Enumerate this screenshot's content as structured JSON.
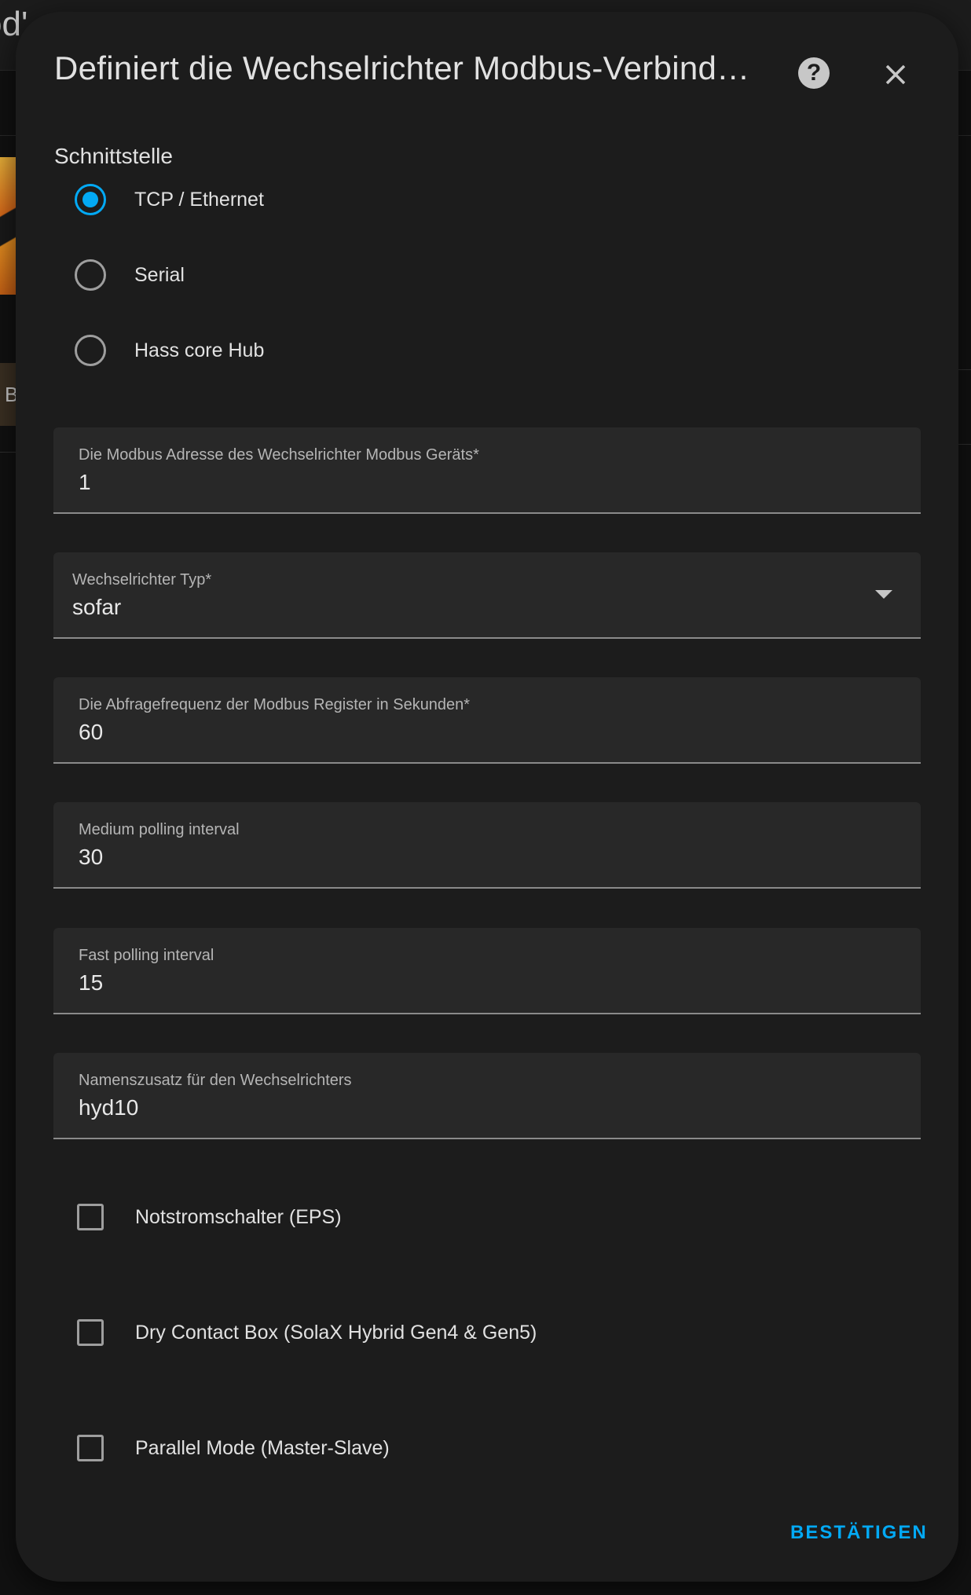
{
  "background": {
    "title_fragment": "od'",
    "chip_text": "B"
  },
  "dialog": {
    "title": "Definiert die Wechselrichter Modbus-Verbind…",
    "help_icon": "help-circle-icon",
    "close_icon": "close-icon",
    "interface": {
      "label": "Schnittstelle",
      "options": [
        {
          "label": "TCP / Ethernet",
          "selected": true
        },
        {
          "label": "Serial",
          "selected": false
        },
        {
          "label": "Hass core Hub",
          "selected": false
        }
      ]
    },
    "fields": {
      "modbus_address": {
        "label": "Die Modbus Adresse des Wechselrichter Modbus Geräts*",
        "value": "1"
      },
      "inverter_type": {
        "label": "Wechselrichter Typ*",
        "value": "sofar"
      },
      "polling_frequency": {
        "label": "Die Abfragefrequenz der Modbus Register in Sekunden*",
        "value": "60"
      },
      "medium_polling": {
        "label": "Medium polling interval",
        "value": "30"
      },
      "fast_polling": {
        "label": "Fast polling interval",
        "value": "15"
      },
      "name_suffix": {
        "label": "Namenszusatz für den Wechselrichters",
        "value": "hyd10"
      }
    },
    "checkboxes": [
      {
        "label": "Notstromschalter (EPS)",
        "checked": false
      },
      {
        "label": "Dry Contact Box (SolaX Hybrid Gen4 & Gen5)",
        "checked": false
      },
      {
        "label": "Parallel Mode (Master-Slave)",
        "checked": false
      }
    ],
    "confirm_label": "BESTÄTIGEN"
  },
  "colors": {
    "accent": "#03a9f4",
    "dialog_bg": "#1c1c1c",
    "field_bg": "#282828"
  }
}
